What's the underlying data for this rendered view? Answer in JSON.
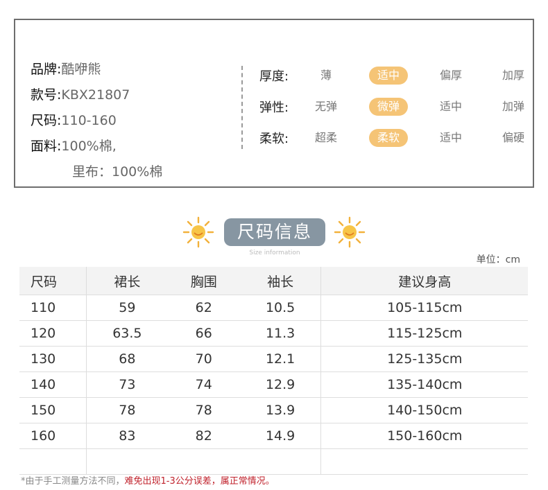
{
  "specs": {
    "brand_label": "品牌:",
    "brand_value": "酷咿熊",
    "model_label": "款号:",
    "model_value": "KBX21807",
    "size_label": "尺码:",
    "size_value": "110-160",
    "fabric_label": "面料:",
    "fabric_value": "100%棉,",
    "lining_value": "里布：100%棉"
  },
  "attributes": [
    {
      "label": "厚度:",
      "options": [
        "薄",
        "适中",
        "偏厚",
        "加厚"
      ],
      "selected": 1
    },
    {
      "label": "弹性:",
      "options": [
        "无弹",
        "微弹",
        "适中",
        "加弹"
      ],
      "selected": 1
    },
    {
      "label": "柔软:",
      "options": [
        "超柔",
        "柔软",
        "适中",
        "偏硬"
      ],
      "selected": 1
    }
  ],
  "section": {
    "title": "尺码信息",
    "subtitle": "Size information",
    "unit": "单位：cm"
  },
  "colors": {
    "selected_pill": "#f5c476",
    "title_pill": "#8796a2",
    "note_red": "#c0212b"
  },
  "table": {
    "headers": [
      "尺码",
      "裙长",
      "胸围",
      "袖长",
      "建议身高"
    ],
    "rows": [
      [
        "110",
        "59",
        "62",
        "10.5",
        "105-115cm"
      ],
      [
        "120",
        "63.5",
        "66",
        "11.3",
        "115-125cm"
      ],
      [
        "130",
        "68",
        "70",
        "12.1",
        "125-135cm"
      ],
      [
        "140",
        "73",
        "74",
        "12.9",
        "135-140cm"
      ],
      [
        "150",
        "78",
        "78",
        "13.9",
        "140-150cm"
      ],
      [
        "160",
        "83",
        "82",
        "14.9",
        "150-160cm"
      ]
    ]
  },
  "note": {
    "prefix": "*由于手工测量方法不同，",
    "emphasis": "难免出现1-3公分误差，属正常情况。"
  }
}
